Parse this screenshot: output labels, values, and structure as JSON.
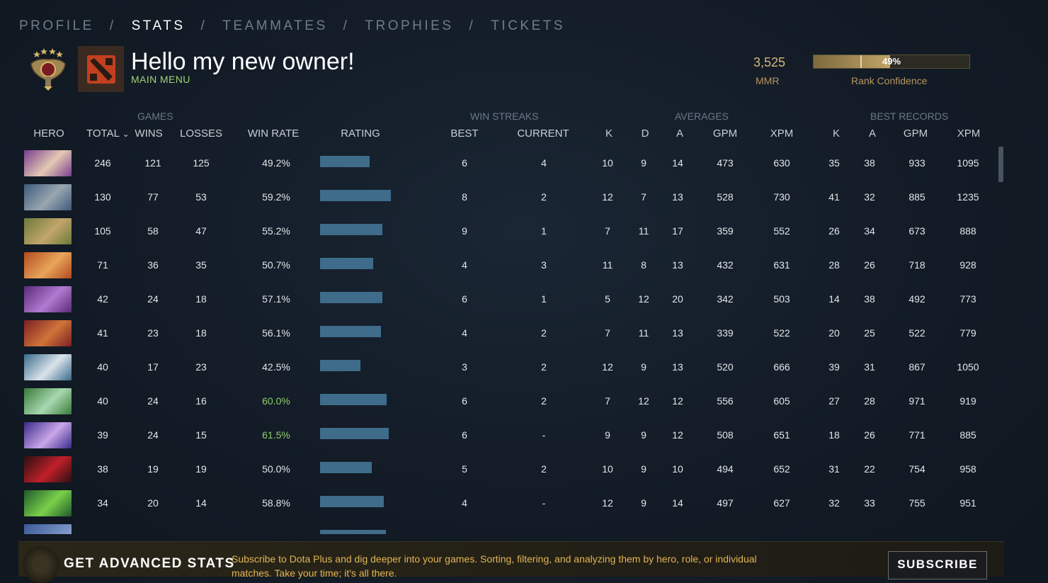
{
  "nav": {
    "tabs": [
      "PROFILE",
      "STATS",
      "TEAMMATES",
      "TROPHIES",
      "TICKETS"
    ],
    "active": "STATS",
    "separator": "/"
  },
  "header": {
    "title": "Hello my new owner!",
    "subtitle": "MAIN MENU",
    "mmr_value": "3,525",
    "mmr_label": "MMR",
    "rank_confidence_percent": 49,
    "rank_confidence_text": "49%",
    "rank_confidence_label": "Rank Confidence"
  },
  "table": {
    "groups": {
      "games": "GAMES",
      "win_streaks": "WIN STREAKS",
      "averages": "AVERAGES",
      "best_records": "BEST RECORDS"
    },
    "columns": {
      "hero": "HERO",
      "total": "TOTAL",
      "sort_indicator": "⌄",
      "wins": "WINS",
      "losses": "LOSSES",
      "win_rate": "WIN RATE",
      "rating": "RATING",
      "best": "BEST",
      "current": "CURRENT",
      "k": "K",
      "d": "D",
      "a": "A",
      "gpm": "GPM",
      "xpm": "XPM",
      "best_k": "K",
      "best_a": "A",
      "best_gpm": "GPM",
      "best_xpm": "XPM"
    },
    "rows": [
      {
        "total": "246",
        "wins": "121",
        "losses": "125",
        "win_rate": "49.2%",
        "rating": 0.7,
        "best": "6",
        "current": "4",
        "k": "10",
        "d": "9",
        "a": "14",
        "gpm": "473",
        "xpm": "630",
        "bk": "35",
        "ba": "38",
        "bgpm": "933",
        "bxpm": "1095",
        "high": false,
        "c1": "#7a3d8e",
        "c2": "#e3c9b3"
      },
      {
        "total": "130",
        "wins": "77",
        "losses": "53",
        "win_rate": "59.2%",
        "rating": 1.0,
        "best": "8",
        "current": "2",
        "k": "12",
        "d": "7",
        "a": "13",
        "gpm": "528",
        "xpm": "730",
        "bk": "41",
        "ba": "32",
        "bgpm": "885",
        "bxpm": "1235",
        "high": false,
        "c1": "#3d5a7a",
        "c2": "#9aa6b0"
      },
      {
        "total": "105",
        "wins": "58",
        "losses": "47",
        "win_rate": "55.2%",
        "rating": 0.88,
        "best": "9",
        "current": "1",
        "k": "7",
        "d": "11",
        "a": "17",
        "gpm": "359",
        "xpm": "552",
        "bk": "26",
        "ba": "34",
        "bgpm": "673",
        "bxpm": "888",
        "high": false,
        "c1": "#6a7a3a",
        "c2": "#c2a56a"
      },
      {
        "total": "71",
        "wins": "36",
        "losses": "35",
        "win_rate": "50.7%",
        "rating": 0.75,
        "best": "4",
        "current": "3",
        "k": "11",
        "d": "8",
        "a": "13",
        "gpm": "432",
        "xpm": "631",
        "bk": "28",
        "ba": "26",
        "bgpm": "718",
        "bxpm": "928",
        "high": false,
        "c1": "#b24a1f",
        "c2": "#e8a55a"
      },
      {
        "total": "42",
        "wins": "24",
        "losses": "18",
        "win_rate": "57.1%",
        "rating": 0.88,
        "best": "6",
        "current": "1",
        "k": "5",
        "d": "12",
        "a": "20",
        "gpm": "342",
        "xpm": "503",
        "bk": "14",
        "ba": "38",
        "bgpm": "492",
        "bxpm": "773",
        "high": false,
        "c1": "#5a2a7a",
        "c2": "#b07ad0"
      },
      {
        "total": "41",
        "wins": "23",
        "losses": "18",
        "win_rate": "56.1%",
        "rating": 0.86,
        "best": "4",
        "current": "2",
        "k": "7",
        "d": "11",
        "a": "13",
        "gpm": "339",
        "xpm": "522",
        "bk": "20",
        "ba": "25",
        "bgpm": "522",
        "bxpm": "779",
        "high": false,
        "c1": "#7a1f22",
        "c2": "#d0743a"
      },
      {
        "total": "40",
        "wins": "17",
        "losses": "23",
        "win_rate": "42.5%",
        "rating": 0.57,
        "best": "3",
        "current": "2",
        "k": "12",
        "d": "9",
        "a": "13",
        "gpm": "520",
        "xpm": "666",
        "bk": "39",
        "ba": "31",
        "bgpm": "867",
        "bxpm": "1050",
        "high": false,
        "c1": "#3a6a8a",
        "c2": "#d9e3ea"
      },
      {
        "total": "40",
        "wins": "24",
        "losses": "16",
        "win_rate": "60.0%",
        "rating": 0.94,
        "best": "6",
        "current": "2",
        "k": "7",
        "d": "12",
        "a": "12",
        "gpm": "556",
        "xpm": "605",
        "bk": "27",
        "ba": "28",
        "bgpm": "971",
        "bxpm": "919",
        "high": true,
        "c1": "#3a7a3a",
        "c2": "#a8d8b0"
      },
      {
        "total": "39",
        "wins": "24",
        "losses": "15",
        "win_rate": "61.5%",
        "rating": 0.97,
        "best": "6",
        "current": "-",
        "k": "9",
        "d": "9",
        "a": "12",
        "gpm": "508",
        "xpm": "651",
        "bk": "18",
        "ba": "26",
        "bgpm": "771",
        "bxpm": "885",
        "high": true,
        "c1": "#3a2a8a",
        "c2": "#c9a6e8"
      },
      {
        "total": "38",
        "wins": "19",
        "losses": "19",
        "win_rate": "50.0%",
        "rating": 0.73,
        "best": "5",
        "current": "2",
        "k": "10",
        "d": "9",
        "a": "10",
        "gpm": "494",
        "xpm": "652",
        "bk": "31",
        "ba": "22",
        "bgpm": "754",
        "bxpm": "958",
        "high": false,
        "c1": "#2a0f12",
        "c2": "#c0202a"
      },
      {
        "total": "34",
        "wins": "20",
        "losses": "14",
        "win_rate": "58.8%",
        "rating": 0.9,
        "best": "4",
        "current": "-",
        "k": "12",
        "d": "9",
        "a": "14",
        "gpm": "497",
        "xpm": "627",
        "bk": "32",
        "ba": "33",
        "bgpm": "755",
        "bxpm": "951",
        "high": false,
        "c1": "#1f5a2a",
        "c2": "#7ad04a"
      }
    ]
  },
  "footer": {
    "title": "GET ADVANCED STATS",
    "description": "Subscribe to Dota Plus and dig deeper into your games. Sorting, filtering, and analyzing them by hero, role, or individual matches. Take your time; it's all there.",
    "button": "SUBSCRIBE"
  }
}
